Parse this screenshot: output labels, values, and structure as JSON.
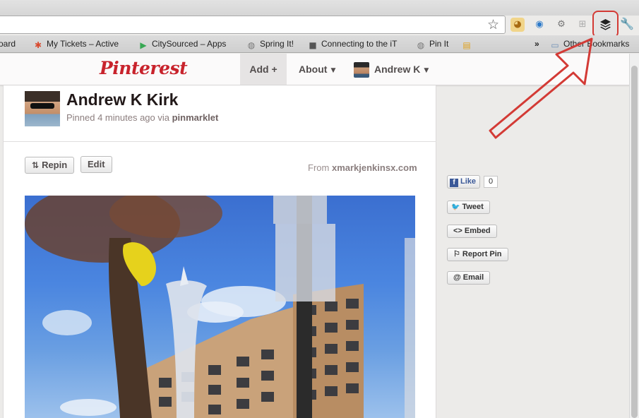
{
  "browser": {
    "bookmarks": [
      {
        "label": "oard",
        "icon": "dashboard-icon"
      },
      {
        "label": "My Tickets – Active",
        "icon": "ticket-icon"
      },
      {
        "label": "CitySourced – Apps",
        "icon": "google-play-icon"
      },
      {
        "label": "Spring It!",
        "icon": "globe-icon"
      },
      {
        "label": "Connecting to the iT",
        "icon": "apple-icon"
      },
      {
        "label": "Pin It",
        "icon": "globe-icon"
      }
    ],
    "overflow_label": "»",
    "other_bookmarks_label": "Other Bookmarks"
  },
  "header": {
    "logo": "Pinterest",
    "nav": {
      "add_label": "Add +",
      "about_label": "About",
      "user_label": "Andrew K"
    }
  },
  "pin": {
    "pinner_name": "Andrew K Kirk",
    "meta_prefix": "Pinned 4 minutes ago via",
    "meta_source": "pinmarklet",
    "repin_label": "Repin",
    "edit_label": "Edit",
    "from_prefix": "From",
    "from_domain": "xmarkjenkinsx.com"
  },
  "sidebar": {
    "like_label": "Like",
    "like_count": "0",
    "tweet_label": "Tweet",
    "embed_label": "<> Embed",
    "report_label": "⚐ Report Pin",
    "email_label": "@ Email"
  },
  "colors": {
    "pinterest_red": "#c8232c",
    "highlight_red": "#d33a35",
    "facebook_blue": "#3b5998",
    "twitter_blue": "#2aa3ef"
  }
}
